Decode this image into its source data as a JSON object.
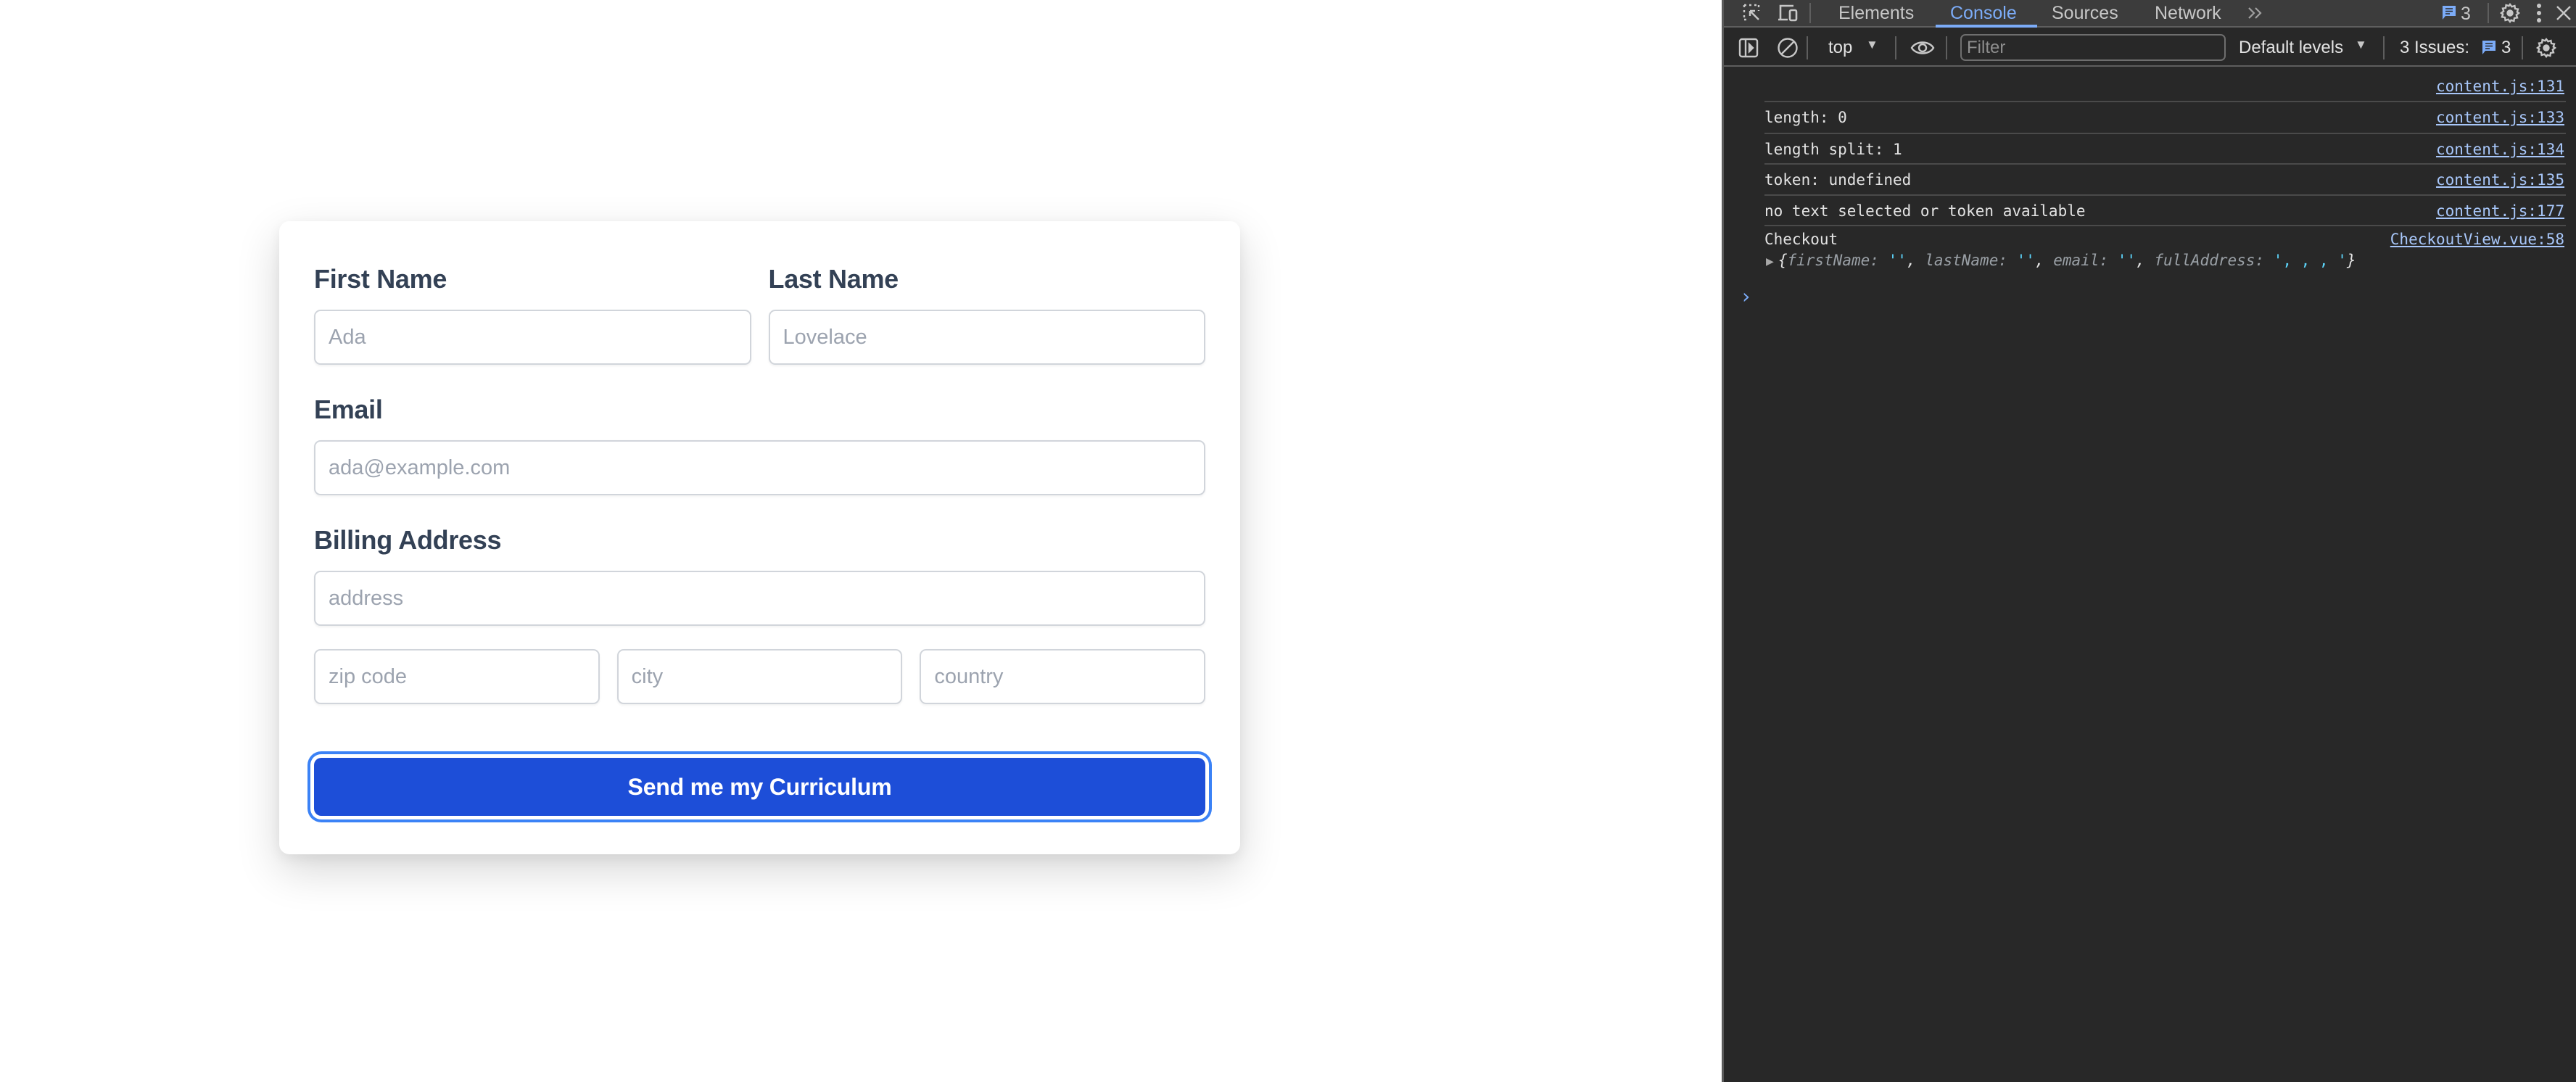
{
  "form": {
    "first_name": {
      "label": "First Name",
      "placeholder": "Ada",
      "value": ""
    },
    "last_name": {
      "label": "Last Name",
      "placeholder": "Lovelace",
      "value": ""
    },
    "email": {
      "label": "Email",
      "placeholder": "ada@example.com",
      "value": ""
    },
    "billing": {
      "label": "Billing Address",
      "address_placeholder": "address",
      "zip_placeholder": "zip code",
      "city_placeholder": "city",
      "country_placeholder": "country"
    },
    "submit_label": "Send me my Curriculum",
    "accent_color": "#1d4ed8"
  },
  "devtools": {
    "tabs": [
      {
        "label": "Elements",
        "active": false
      },
      {
        "label": "Console",
        "active": true
      },
      {
        "label": "Sources",
        "active": false
      },
      {
        "label": "Network",
        "active": false
      }
    ],
    "more_tabs_icon": "chevron-double-right-icon",
    "messages_badge_count": "3",
    "toolbar": {
      "context": "top",
      "filter_placeholder": "Filter",
      "levels": "Default levels",
      "issues_label": "3 Issues:",
      "issues_count": "3"
    },
    "console_rows": [
      {
        "message": "",
        "source": "content.js:131"
      },
      {
        "message": "length: 0",
        "source": "content.js:133"
      },
      {
        "message": "length split: 1",
        "source": "content.js:134"
      },
      {
        "message": "token: undefined",
        "source": "content.js:135"
      },
      {
        "message": "no text selected or token available",
        "source": "content.js:177"
      },
      {
        "message": "Checkout",
        "source": "CheckoutView.vue:58"
      }
    ],
    "object_preview": {
      "open": "{",
      "k1": "firstName",
      "v1": "''",
      "k2": "lastName",
      "v2": "''",
      "k3": "email",
      "v3": "''",
      "k4": "fullAddress",
      "v4": "', , , '",
      "close": "}"
    },
    "prompt_symbol": "›"
  }
}
